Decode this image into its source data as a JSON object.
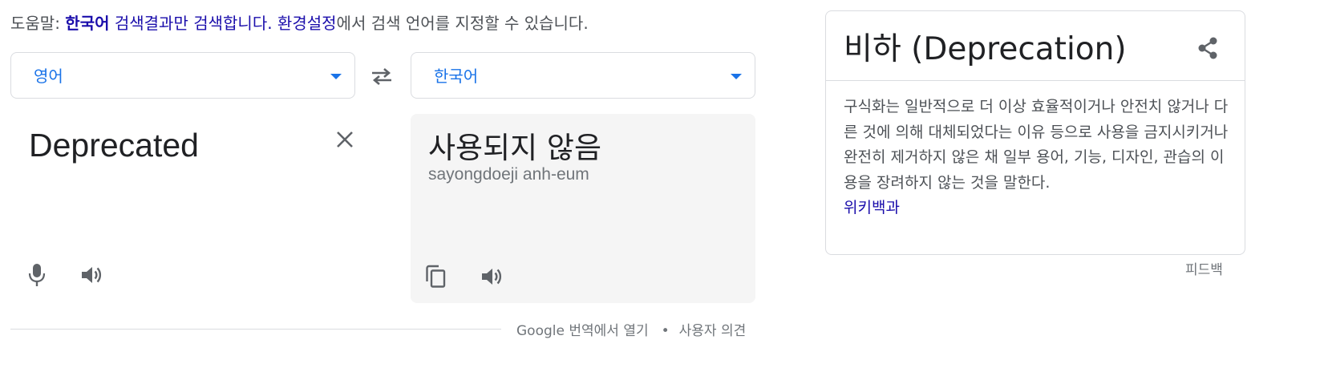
{
  "tip": {
    "prefix": "도움말: ",
    "lang_strong": "한국어",
    "search_link": " 검색결과만 검색합니다.",
    "settings_link": " 환경설정",
    "suffix": "에서 검색 언어를 지정할 수 있습니다."
  },
  "translator": {
    "source_lang": "영어",
    "target_lang": "한국어",
    "source_text": "Deprecated",
    "target_text": "사용되지 않음",
    "romanization": "sayongdoeji anh-eum"
  },
  "footer": {
    "open_link": "Google 번역에서 열기",
    "separator": "•",
    "feedback_link": "사용자 의견"
  },
  "knowledge_panel": {
    "title": "비하 (Deprecation)",
    "description": "구식화는 일반적으로 더 이상 효율적이거나 안전치 않거나 다른 것에 의해 대체되었다는 이유 등으로 사용을 금지시키거나 완전히 제거하지 않은 채 일부 용어, 기능, 디자인, 관습의 이용을 장려하지 않는 것을 말한다.",
    "source_link": "위키백과",
    "feedback": "피드백"
  },
  "icons": {
    "swap": "swap-icon",
    "clear": "close-icon",
    "mic": "microphone-icon",
    "speaker": "speaker-icon",
    "copy": "copy-icon",
    "share": "share-icon",
    "dropdown": "caret-down-icon"
  },
  "colors": {
    "link": "#1a0dab",
    "accent": "#1a73e8",
    "icon": "#5f6368",
    "panel_bg": "#f5f5f5"
  }
}
